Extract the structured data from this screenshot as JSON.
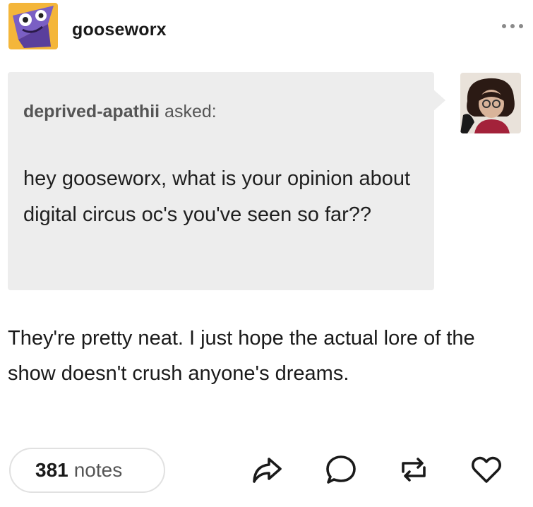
{
  "post": {
    "blog_name": "gooseworx",
    "more_icon": "more-options-icon"
  },
  "ask": {
    "asker_name": "deprived-apathii",
    "asked_label": "asked:",
    "question": "hey gooseworx, what is your opinion about digital circus oc's you've seen so far??"
  },
  "answer": {
    "text": "They're pretty neat. I just hope the actual lore of the show doesn't crush anyone's dreams."
  },
  "footer": {
    "notes_count": "381",
    "notes_label": "notes",
    "actions": [
      "share-icon",
      "reply-icon",
      "reblog-icon",
      "like-icon"
    ]
  },
  "colors": {
    "ask_background": "#ededed",
    "text": "#1a1a1a",
    "muted": "#555555"
  }
}
